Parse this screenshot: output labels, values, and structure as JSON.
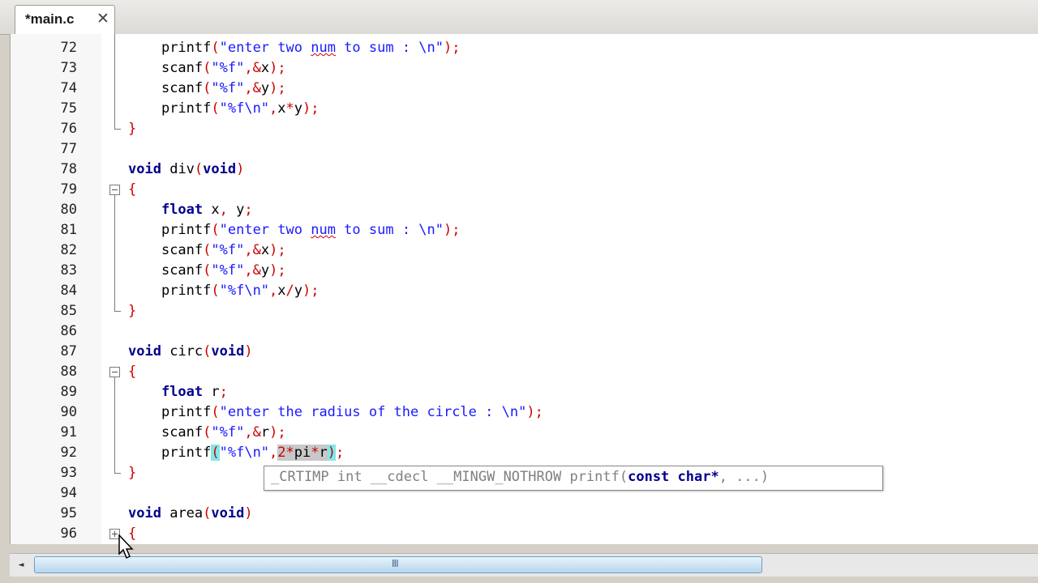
{
  "tab": {
    "label": "*main.c",
    "close": "✕"
  },
  "lines": [
    {
      "n": "72",
      "tokens": [
        [
          "    ",
          ""
        ],
        [
          "printf",
          "id"
        ],
        [
          "(",
          "op"
        ],
        [
          "\"enter two ",
          "str"
        ],
        [
          "num",
          "str sq"
        ],
        [
          " to sum : \\n\"",
          "str"
        ],
        [
          ");",
          "op"
        ]
      ]
    },
    {
      "n": "73",
      "tokens": [
        [
          "    ",
          ""
        ],
        [
          "scanf",
          "id"
        ],
        [
          "(",
          "op"
        ],
        [
          "\"%f\"",
          "str"
        ],
        [
          ",&",
          "op"
        ],
        [
          "x",
          "id"
        ],
        [
          ");",
          "op"
        ]
      ]
    },
    {
      "n": "74",
      "tokens": [
        [
          "    ",
          ""
        ],
        [
          "scanf",
          "id"
        ],
        [
          "(",
          "op"
        ],
        [
          "\"%f\"",
          "str"
        ],
        [
          ",&",
          "op"
        ],
        [
          "y",
          "id"
        ],
        [
          ");",
          "op"
        ]
      ]
    },
    {
      "n": "75",
      "tokens": [
        [
          "    ",
          ""
        ],
        [
          "printf",
          "id"
        ],
        [
          "(",
          "op"
        ],
        [
          "\"%f\\n\"",
          "str"
        ],
        [
          ",",
          "op"
        ],
        [
          "x",
          "id"
        ],
        [
          "*",
          "op"
        ],
        [
          "y",
          "id"
        ],
        [
          ");",
          "op"
        ]
      ]
    },
    {
      "n": "76",
      "tokens": [
        [
          "}",
          "op"
        ]
      ]
    },
    {
      "n": "77",
      "tokens": []
    },
    {
      "n": "78",
      "tokens": [
        [
          "void",
          "kw"
        ],
        [
          " ",
          ""
        ],
        [
          "div",
          "id"
        ],
        [
          "(",
          "op"
        ],
        [
          "void",
          "kw"
        ],
        [
          ")",
          "op"
        ]
      ]
    },
    {
      "n": "79",
      "tokens": [
        [
          "{",
          "op"
        ]
      ]
    },
    {
      "n": "80",
      "tokens": [
        [
          "    ",
          ""
        ],
        [
          "float",
          "kw"
        ],
        [
          " ",
          ""
        ],
        [
          "x",
          "id"
        ],
        [
          ", ",
          "op"
        ],
        [
          "y",
          "id"
        ],
        [
          ";",
          "op"
        ]
      ]
    },
    {
      "n": "81",
      "tokens": [
        [
          "    ",
          ""
        ],
        [
          "printf",
          "id"
        ],
        [
          "(",
          "op"
        ],
        [
          "\"enter two ",
          "str"
        ],
        [
          "num",
          "str sq"
        ],
        [
          " to sum : \\n\"",
          "str"
        ],
        [
          ");",
          "op"
        ]
      ]
    },
    {
      "n": "82",
      "tokens": [
        [
          "    ",
          ""
        ],
        [
          "scanf",
          "id"
        ],
        [
          "(",
          "op"
        ],
        [
          "\"%f\"",
          "str"
        ],
        [
          ",&",
          "op"
        ],
        [
          "x",
          "id"
        ],
        [
          ");",
          "op"
        ]
      ]
    },
    {
      "n": "83",
      "tokens": [
        [
          "    ",
          ""
        ],
        [
          "scanf",
          "id"
        ],
        [
          "(",
          "op"
        ],
        [
          "\"%f\"",
          "str"
        ],
        [
          ",&",
          "op"
        ],
        [
          "y",
          "id"
        ],
        [
          ");",
          "op"
        ]
      ]
    },
    {
      "n": "84",
      "tokens": [
        [
          "    ",
          ""
        ],
        [
          "printf",
          "id"
        ],
        [
          "(",
          "op"
        ],
        [
          "\"%f\\n\"",
          "str"
        ],
        [
          ",",
          "op"
        ],
        [
          "x",
          "id"
        ],
        [
          "/",
          "op"
        ],
        [
          "y",
          "id"
        ],
        [
          ");",
          "op"
        ]
      ]
    },
    {
      "n": "85",
      "tokens": [
        [
          "}",
          "op"
        ]
      ]
    },
    {
      "n": "86",
      "tokens": []
    },
    {
      "n": "87",
      "tokens": [
        [
          "void",
          "kw"
        ],
        [
          " ",
          ""
        ],
        [
          "circ",
          "id"
        ],
        [
          "(",
          "op"
        ],
        [
          "void",
          "kw"
        ],
        [
          ")",
          "op"
        ]
      ]
    },
    {
      "n": "88",
      "tokens": [
        [
          "{",
          "op"
        ]
      ]
    },
    {
      "n": "89",
      "tokens": [
        [
          "    ",
          ""
        ],
        [
          "float",
          "kw"
        ],
        [
          " ",
          ""
        ],
        [
          "r",
          "id"
        ],
        [
          ";",
          "op"
        ]
      ]
    },
    {
      "n": "90",
      "tokens": [
        [
          "    ",
          ""
        ],
        [
          "printf",
          "id"
        ],
        [
          "(",
          "op"
        ],
        [
          "\"enter the radius of the circle : \\n\"",
          "str"
        ],
        [
          ");",
          "op"
        ]
      ]
    },
    {
      "n": "91",
      "tokens": [
        [
          "    ",
          ""
        ],
        [
          "scanf",
          "id"
        ],
        [
          "(",
          "op"
        ],
        [
          "\"%f\"",
          "str"
        ],
        [
          ",&",
          "op"
        ],
        [
          "r",
          "id"
        ],
        [
          ");",
          "op"
        ]
      ]
    },
    {
      "n": "92",
      "tokens": [
        [
          "    ",
          ""
        ],
        [
          "printf",
          "id"
        ],
        [
          "(",
          "op hb"
        ],
        [
          "\"%f\\n\"",
          "str"
        ],
        [
          ",",
          "op"
        ],
        [
          "2*",
          "op hs"
        ],
        [
          "pi",
          "id hs"
        ],
        [
          "*",
          "op hs"
        ],
        [
          "r",
          "id hs"
        ],
        [
          ")",
          "op hb"
        ],
        [
          ";",
          "op"
        ]
      ]
    },
    {
      "n": "93",
      "tokens": [
        [
          "}",
          "op"
        ]
      ]
    },
    {
      "n": "94",
      "tokens": []
    },
    {
      "n": "95",
      "tokens": [
        [
          "void",
          "kw"
        ],
        [
          " ",
          ""
        ],
        [
          "area",
          "id"
        ],
        [
          "(",
          "op"
        ],
        [
          "void",
          "kw"
        ],
        [
          ")",
          "op"
        ]
      ]
    },
    {
      "n": "96",
      "tokens": [
        [
          "{",
          "op"
        ]
      ]
    }
  ],
  "tooltip": {
    "prefix": "_CRTIMP int __cdecl __MINGW_NOTHROW printf(",
    "bold": "const char*",
    "suffix": ", ...)"
  },
  "scrollbar": {
    "left_arrow": "◄",
    "grip": "III"
  }
}
